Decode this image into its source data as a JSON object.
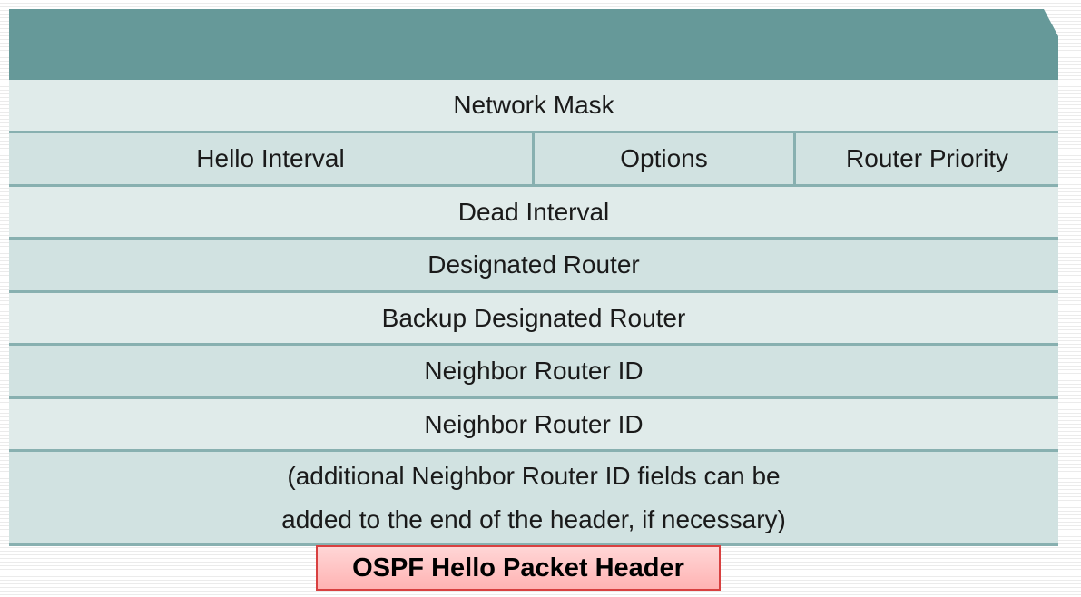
{
  "packet": {
    "network_mask": "Network Mask",
    "hello_interval": "Hello Interval",
    "options": "Options",
    "router_priority": "Router Priority",
    "dead_interval": "Dead Interval",
    "designated_router": "Designated Router",
    "backup_designated_router": "Backup Designated Router",
    "neighbor_router_id_1": "Neighbor Router ID",
    "neighbor_router_id_2": "Neighbor Router ID",
    "note_line_1": "(additional Neighbor Router ID fields can be",
    "note_line_2": "added to the end of the header, if necessary)"
  },
  "caption": "OSPF Hello Packet Header",
  "colors": {
    "header": "#669999",
    "row_light": "#e0ebea",
    "row_dark": "#d1e2e1",
    "border": "#88b0b0",
    "caption_border": "#d84040"
  }
}
